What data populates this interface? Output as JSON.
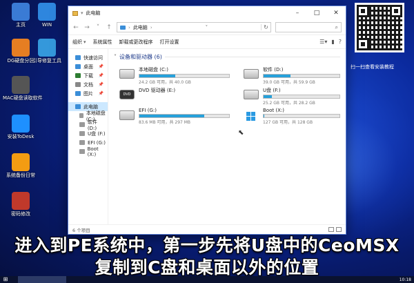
{
  "desktop": {
    "icons": [
      {
        "label": "主页",
        "icon": "computer-icon",
        "color": "#3a7bd5"
      },
      {
        "label": "WIN",
        "icon": "windows-icon",
        "color": "#2e86de"
      },
      {
        "label": "DG硬盘分区",
        "icon": "dg-icon",
        "color": "#e67e22"
      },
      {
        "label": "引导修复工具",
        "icon": "wrench-icon",
        "color": "#3498db"
      },
      {
        "label": "MAC硬盘读取软件",
        "icon": "apple-icon",
        "color": "#555555"
      },
      {
        "label": "安装ToDesk",
        "icon": "todesk-icon",
        "color": "#1e90ff"
      },
      {
        "label": "系统备份日常",
        "icon": "gear-icon",
        "color": "#f39c12"
      },
      {
        "label": "密码修改",
        "icon": "password-icon",
        "color": "#c0392b"
      }
    ]
  },
  "window": {
    "title": "此电脑",
    "address_path": "此电脑",
    "toolbar": {
      "organize": "组织",
      "properties": "系统属性",
      "uninstall": "卸载或更改程序",
      "open_settings": "打开设置"
    },
    "nav_items": [
      {
        "label": "快速访问",
        "pinned": false,
        "selected": false
      },
      {
        "label": "桌面",
        "pinned": true,
        "selected": false
      },
      {
        "label": "下载",
        "pinned": true,
        "selected": false
      },
      {
        "label": "文档",
        "pinned": true,
        "selected": false
      },
      {
        "label": "图片",
        "pinned": true,
        "selected": false
      },
      {
        "label": "此电脑",
        "pinned": false,
        "selected": true
      },
      {
        "label": "本地磁盘 (C:)",
        "pinned": false,
        "selected": false
      },
      {
        "label": "软件 (D:)",
        "pinned": false,
        "selected": false
      },
      {
        "label": "U盘 (F:)",
        "pinned": false,
        "selected": false
      },
      {
        "label": "EFI (G:)",
        "pinned": false,
        "selected": false
      },
      {
        "label": "Boot (X:)",
        "pinned": false,
        "selected": false
      }
    ],
    "group_title": "设备和驱动器 (6)",
    "drives": [
      {
        "name": "本地磁盘 (C:)",
        "free_text": "24.2 GB 可用，共 40.0 GB",
        "used_fraction": 0.4,
        "icon": "hdd-icon",
        "show_bar": true
      },
      {
        "name": "软件 (D:)",
        "free_text": "39.0 GB 可用，共 59.9 GB",
        "used_fraction": 0.35,
        "icon": "hdd-icon",
        "show_bar": true
      },
      {
        "name": "DVD 驱动器 (E:)",
        "free_text": "",
        "used_fraction": 0,
        "icon": "dvd-icon",
        "show_bar": false
      },
      {
        "name": "U盘 (F:)",
        "free_text": "25.2 GB 可用，共 28.2 GB",
        "used_fraction": 0.11,
        "icon": "hdd-icon",
        "show_bar": true
      },
      {
        "name": "EFI (G:)",
        "free_text": "83.6 MB 可用，共 297 MB",
        "used_fraction": 0.72,
        "icon": "hdd-icon",
        "show_bar": true
      },
      {
        "name": "Boot (X:)",
        "free_text": "127 GB 可用，共 128 GB",
        "used_fraction": 0.01,
        "icon": "windows-icon",
        "show_bar": true
      }
    ],
    "status_text": "6 个项目"
  },
  "qr_caption": "扫一扫查看安装教程",
  "subtitle": {
    "line1": "进入到PE系统中，第一步先将U盘中的CeoMSX",
    "line2": "复制到C盘和桌面以外的位置"
  },
  "taskbar": {
    "clock": "10:18"
  },
  "colors": {
    "accent": "#26a0da",
    "selection": "#cce8ff"
  }
}
